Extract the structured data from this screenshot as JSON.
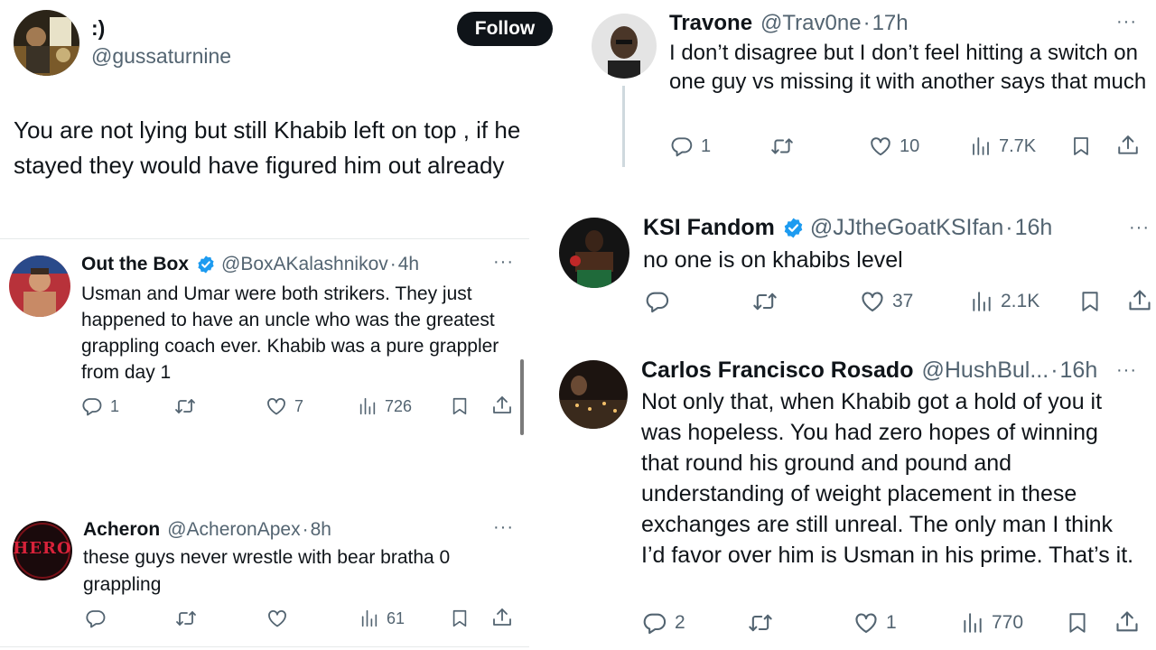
{
  "left": {
    "main": {
      "name": ":)",
      "handle": "@gussaturnine",
      "follow_label": "Follow",
      "text": "You are not lying but still Khabib left on top , if he stayed they would have figured him out already"
    },
    "replies": [
      {
        "name": "Out the Box",
        "handle": "@BoxAKalashnikov",
        "time": "4h",
        "text": "Usman and Umar were both strikers. They just happened to have an uncle who was the greatest grappling coach ever. Khabib was a pure grappler from day 1",
        "replies": "1",
        "likes": "7",
        "views": "726"
      },
      {
        "name": "Acheron",
        "handle": "@AcheronApex",
        "time": "8h",
        "text": "these guys never wrestle with bear bratha 0 grappling",
        "views": "61",
        "avatar_text": "HERO"
      }
    ]
  },
  "right": [
    {
      "name": "Travone",
      "handle": "@Trav0ne",
      "time": "17h",
      "text": "I don’t disagree but I don’t feel hitting a switch on one guy vs missing it with another says that much",
      "replies": "1",
      "likes": "10",
      "views": "7.7K"
    },
    {
      "name": "KSI Fandom",
      "handle": "@JJtheGoatKSIfan",
      "time": "16h",
      "text": "no one is on khabibs level",
      "likes": "37",
      "views": "2.1K"
    },
    {
      "name": "Carlos Francisco Rosado",
      "handle": "@HushBul...",
      "time": "16h",
      "text": "Not only that, when Khabib got a hold of you it was hopeless. You had zero hopes of winning that round his ground and pound and understanding of weight placement in these exchanges are still unreal. The only man I think I’d favor over him is Usman in his prime. That’s it.",
      "replies": "2",
      "likes": "1",
      "views": "770"
    }
  ],
  "icons": {
    "reply": "reply-icon",
    "retweet": "retweet-icon",
    "like": "heart-icon",
    "views": "views-icon",
    "bookmark": "bookmark-icon",
    "share": "share-icon",
    "verified": "verified-badge-icon",
    "more": "more-icon"
  },
  "colors": {
    "text": "#0f1419",
    "secondary": "#536471",
    "verified": "#1d9bf0",
    "follow_bg": "#0f1419",
    "follow_text": "#ffffff"
  }
}
